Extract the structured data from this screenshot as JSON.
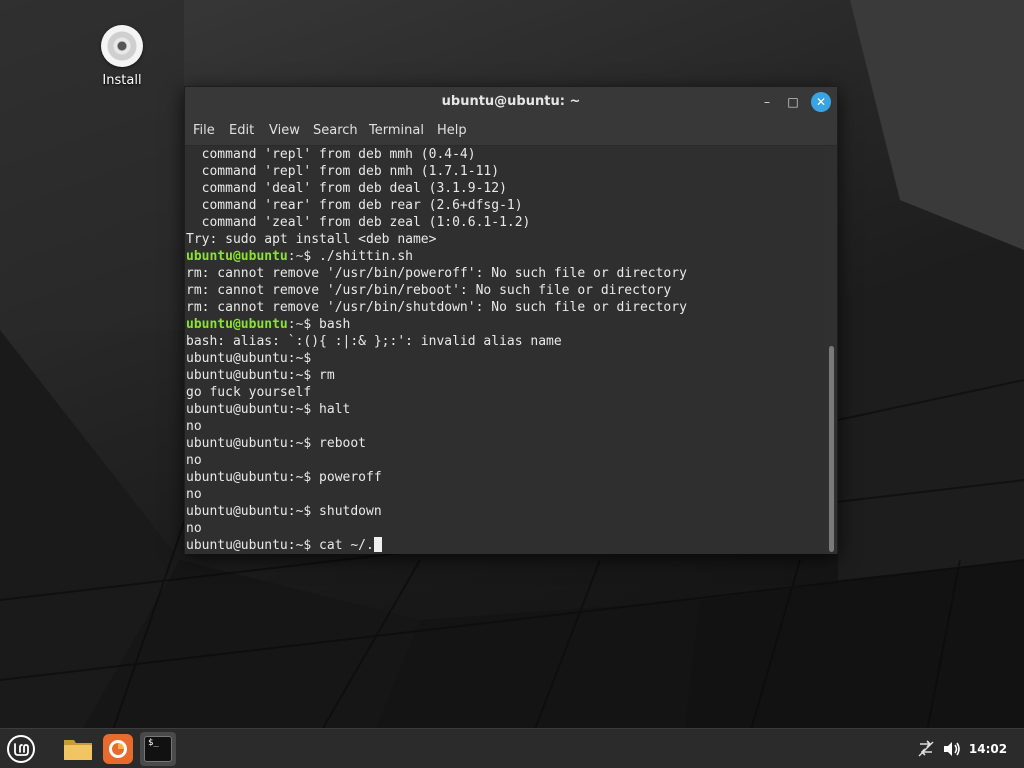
{
  "desktop": {
    "icons": [
      {
        "label": "Install"
      }
    ]
  },
  "window": {
    "title": "ubuntu@ubuntu: ~",
    "controls": {
      "minimize": "–",
      "maximize": "□",
      "close": "✕"
    },
    "menu": [
      "File",
      "Edit",
      "View",
      "Search",
      "Terminal",
      "Help"
    ]
  },
  "terminal": {
    "lines": [
      {
        "text": "  command 'repl' from deb mmh (0.4-4)"
      },
      {
        "text": "  command 'repl' from deb nmh (1.7.1-11)"
      },
      {
        "text": "  command 'deal' from deb deal (3.1.9-12)"
      },
      {
        "text": "  command 'rear' from deb rear (2.6+dfsg-1)"
      },
      {
        "text": "  command 'zeal' from deb zeal (1:0.6.1-1.2)"
      },
      {
        "text": "Try: sudo apt install <deb name>"
      },
      {
        "user": "ubuntu@ubuntu",
        "path": ":~",
        "text": "$ ./shittin.sh"
      },
      {
        "text": "rm: cannot remove '/usr/bin/poweroff': No such file or directory"
      },
      {
        "text": "rm: cannot remove '/usr/bin/reboot': No such file or directory"
      },
      {
        "text": "rm: cannot remove '/usr/bin/shutdown': No such file or directory"
      },
      {
        "user": "ubuntu@ubuntu",
        "path": ":~",
        "text": "$ bash"
      },
      {
        "text": "bash: alias: `:(){ :|:& };:': invalid alias name"
      },
      {
        "text": "ubuntu@ubuntu:~$ "
      },
      {
        "text": "ubuntu@ubuntu:~$ rm"
      },
      {
        "text": "go fuck yourself"
      },
      {
        "text": "ubuntu@ubuntu:~$ halt"
      },
      {
        "text": "no"
      },
      {
        "text": "ubuntu@ubuntu:~$ reboot"
      },
      {
        "text": "no"
      },
      {
        "text": "ubuntu@ubuntu:~$ poweroff"
      },
      {
        "text": "no"
      },
      {
        "text": "ubuntu@ubuntu:~$ shutdown"
      },
      {
        "text": "no"
      },
      {
        "text": "ubuntu@ubuntu:~$ cat ~/."
      }
    ],
    "colors": {
      "prompt_user": "#8ae234",
      "background": "#2f2f2f",
      "text": "#e9e9e9"
    }
  },
  "taskbar": {
    "launchers": [
      {
        "icon": "mint-menu-icon"
      },
      {
        "icon": "folder-icon"
      },
      {
        "icon": "firefox-icon"
      },
      {
        "icon": "terminal-icon",
        "glyph": "$_"
      }
    ],
    "tray": {
      "icons": [
        "network-icon",
        "volume-icon"
      ],
      "clock": "14:02"
    }
  }
}
